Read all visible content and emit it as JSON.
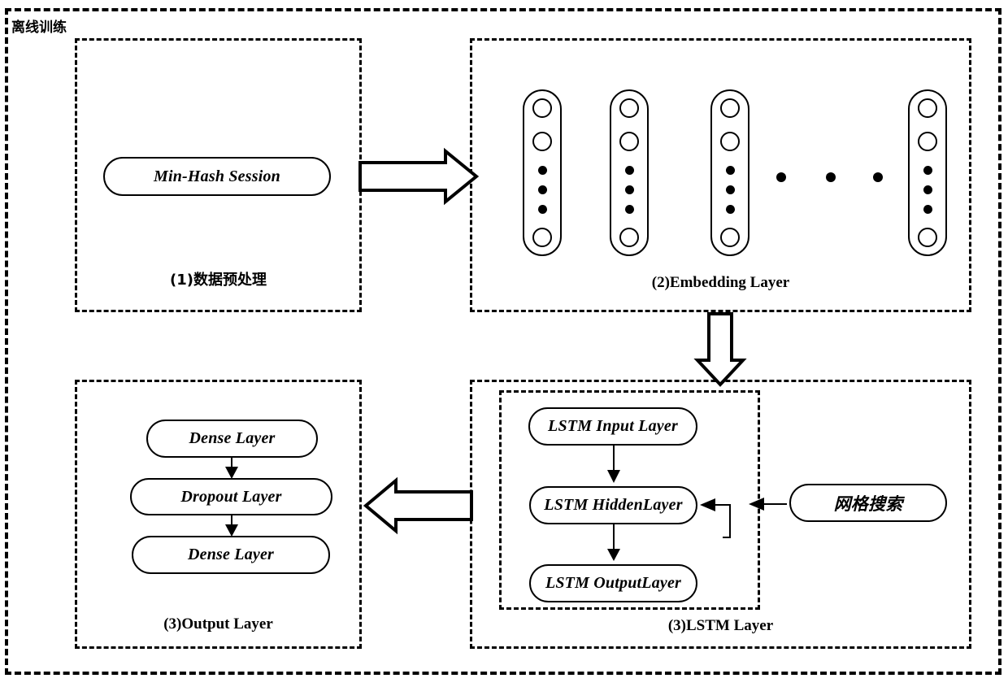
{
  "diagram": {
    "outer_label": "离线训练",
    "sections": [
      {
        "id": "preprocess",
        "caption": "(1)数据预处理"
      },
      {
        "id": "embedding",
        "caption": "(2)Embedding Layer"
      },
      {
        "id": "output",
        "caption": "(3)Output Layer"
      },
      {
        "id": "lstm",
        "caption": "(3)LSTM Layer"
      }
    ]
  },
  "preprocess": {
    "node": "Min-Hash Session"
  },
  "embedding": {
    "capsules": [
      {
        "top_neurons": 2,
        "dots": 3,
        "bottom_neurons": 1
      },
      {
        "top_neurons": 2,
        "dots": 3,
        "bottom_neurons": 1
      },
      {
        "top_neurons": 2,
        "dots": 3,
        "bottom_neurons": 1
      },
      {
        "top_neurons": 2,
        "dots": 3,
        "bottom_neurons": 1
      }
    ],
    "ellipsis_dots": 3
  },
  "output_layer": {
    "nodes": [
      "Dense Layer",
      "Dropout Layer",
      "Dense Layer"
    ]
  },
  "lstm_layer": {
    "nodes": [
      "LSTM Input Layer",
      "LSTM HiddenLayer",
      "LSTM OutputLayer"
    ],
    "grid_search": "网格搜索"
  },
  "colors": {
    "stroke": "#000000",
    "background": "#ffffff"
  }
}
